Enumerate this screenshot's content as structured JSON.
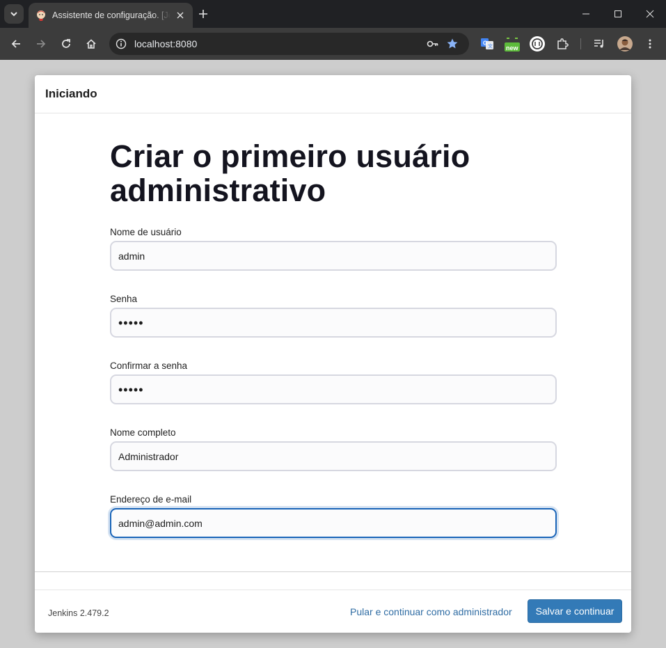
{
  "browser": {
    "tab": {
      "title": "Assistente de configuração. [Jenkins]"
    },
    "omnibox": {
      "url": "localhost:8080"
    },
    "extensions": {
      "badge_new": "new"
    },
    "colors": {
      "frame": "#202124",
      "toolbar": "#3c3c3c",
      "accent": "#8ab4f8"
    }
  },
  "dialog": {
    "header_title": "Iniciando",
    "form_title": "Criar o primeiro usuário administrativo",
    "fields": [
      {
        "label": "Nome de usuário",
        "value": "admin",
        "type": "text"
      },
      {
        "label": "Senha",
        "value": "•••••",
        "type": "password"
      },
      {
        "label": "Confirmar a senha",
        "value": "•••••",
        "type": "password"
      },
      {
        "label": "Nome completo",
        "value": "Administrador",
        "type": "text"
      },
      {
        "label": "Endereço de e-mail",
        "value": "admin@admin.com",
        "type": "text",
        "focused": true
      }
    ],
    "footer": {
      "version": "Jenkins 2.479.2",
      "skip_link": "Pular e continuar como administrador",
      "save_button": "Salvar e continuar"
    },
    "colors": {
      "primary": "#337ab7",
      "link": "#2f6ca3",
      "focus": "#1964b8"
    }
  }
}
